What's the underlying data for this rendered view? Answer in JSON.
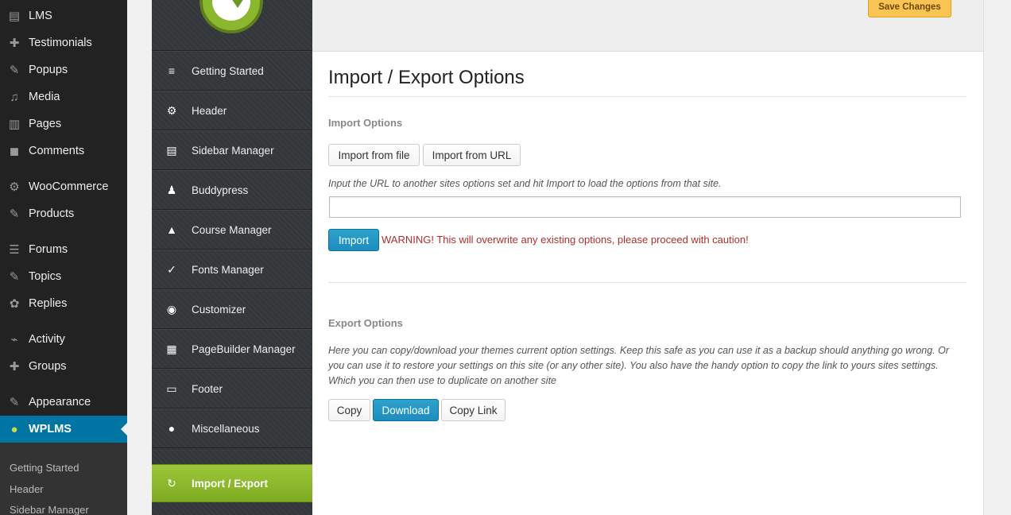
{
  "wp_menu": {
    "items": [
      {
        "label": "LMS",
        "icon": "lms-icon",
        "glyph": "▤"
      },
      {
        "label": "Testimonials",
        "icon": "plus-icon",
        "glyph": "✚"
      },
      {
        "label": "Popups",
        "icon": "pin-icon",
        "glyph": "✎"
      },
      {
        "label": "Media",
        "icon": "media-icon",
        "glyph": "♫"
      },
      {
        "label": "Pages",
        "icon": "pages-icon",
        "glyph": "▥"
      },
      {
        "label": "Comments",
        "icon": "comments-icon",
        "glyph": "◼"
      },
      {
        "label": "WooCommerce",
        "icon": "woocommerce-icon",
        "glyph": "⚙"
      },
      {
        "label": "Products",
        "icon": "products-icon",
        "glyph": "✎"
      },
      {
        "label": "Forums",
        "icon": "forums-icon",
        "glyph": "☰"
      },
      {
        "label": "Topics",
        "icon": "topics-icon",
        "glyph": "✎"
      },
      {
        "label": "Replies",
        "icon": "replies-icon",
        "glyph": "✿"
      },
      {
        "label": "Activity",
        "icon": "activity-icon",
        "glyph": "⌁"
      },
      {
        "label": "Groups",
        "icon": "groups-icon",
        "glyph": "✚"
      },
      {
        "label": "Appearance",
        "icon": "appearance-icon",
        "glyph": "✎"
      },
      {
        "label": "WPLMS",
        "icon": "wplms-icon",
        "glyph": "●"
      }
    ],
    "submenu": [
      "Getting Started",
      "Header",
      "Sidebar Manager"
    ]
  },
  "options_menu": {
    "items": [
      {
        "label": "Getting Started",
        "icon": "menu-lines-icon",
        "glyph": "≡"
      },
      {
        "label": "Header",
        "icon": "gear-icon",
        "glyph": "⚙"
      },
      {
        "label": "Sidebar Manager",
        "icon": "sidebar-icon",
        "glyph": "▤"
      },
      {
        "label": "Buddypress",
        "icon": "users-icon",
        "glyph": "♟"
      },
      {
        "label": "Course Manager",
        "icon": "graduation-cap-icon",
        "glyph": "▲"
      },
      {
        "label": "Fonts Manager",
        "icon": "fonts-icon",
        "glyph": "✓"
      },
      {
        "label": "Customizer",
        "icon": "eye-icon",
        "glyph": "◉"
      },
      {
        "label": "PageBuilder Manager",
        "icon": "keyboard-icon",
        "glyph": "▦"
      },
      {
        "label": "Footer",
        "icon": "footer-icon",
        "glyph": "▭"
      },
      {
        "label": "Miscellaneous",
        "icon": "location-pin-icon",
        "glyph": "●"
      },
      {
        "label": "Import / Export",
        "icon": "refresh-icon",
        "glyph": "↻"
      }
    ]
  },
  "header": {
    "save_label": "Save Changes"
  },
  "main": {
    "title": "Import / Export Options",
    "import": {
      "section_label": "Import Options",
      "from_file_label": "Import from file",
      "from_url_label": "Import from URL",
      "description": "Input the URL to another sites options set and hit Import to load the options from that site.",
      "url_value": "",
      "import_label": "Import",
      "warning": "WARNING! This will overwrite any existing options, please proceed with caution!"
    },
    "export": {
      "section_label": "Export Options",
      "description_line1": "Here you can copy/download your themes current option settings. Keep this safe as you can use it as a backup should anything go wrong. Or",
      "description_line2": "you can use it to restore your settings on this site (or any other site). You also have the handy option to copy the link to yours sites settings.",
      "description_line3": "Which you can then use to duplicate on another site",
      "copy_label": "Copy",
      "download_label": "Download",
      "copy_link_label": "Copy Link"
    }
  },
  "colors": {
    "wp_active": "#0074a2",
    "options_active": "#8ab72d",
    "save_button": "#f9c453",
    "primary_button": "#2ea2cc",
    "warning": "#b32d2e"
  }
}
